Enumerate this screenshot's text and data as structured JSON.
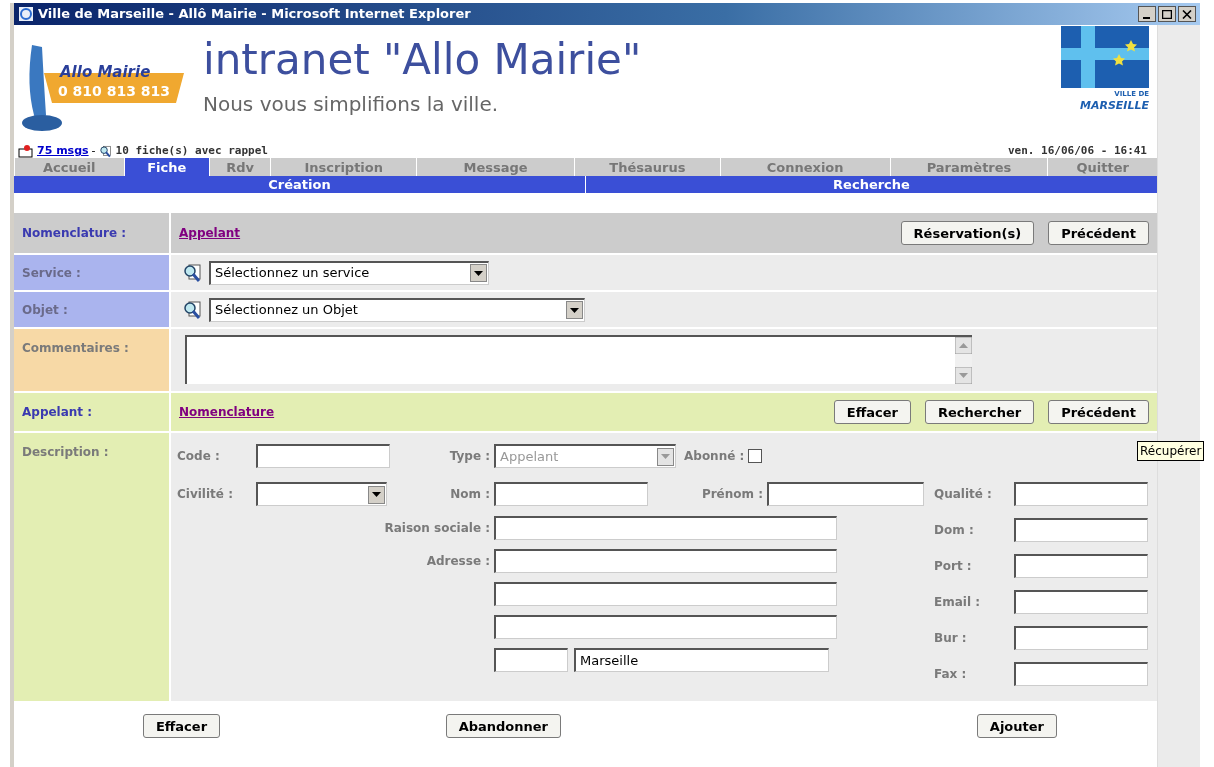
{
  "window": {
    "title": "Ville de Marseille - Allô Mairie - Microsoft Internet Explorer"
  },
  "header": {
    "logo_name": "Allo Mairie",
    "logo_phone": "0 810 813 813",
    "title": "intranet \"Allo Mairie\"",
    "slogan": "Nous vous simplifions la ville.",
    "city_logo": [
      "VILLE DE",
      "MARSEILLE"
    ]
  },
  "info_bar": {
    "messages_link": "75 msgs",
    "separator": "-",
    "reminders": "10 fiche(s) avec rappel",
    "datetime": "ven. 16/06/06 - 16:41"
  },
  "tabs": [
    {
      "label": "Accueil",
      "selected": false
    },
    {
      "label": "Fiche",
      "selected": true
    },
    {
      "label": "Rdv",
      "selected": false
    },
    {
      "label": "Inscription",
      "selected": false
    },
    {
      "label": "Message",
      "selected": false
    },
    {
      "label": "Thésaurus",
      "selected": false
    },
    {
      "label": "Connexion",
      "selected": false
    },
    {
      "label": "Paramètres",
      "selected": false
    },
    {
      "label": "Quitter",
      "selected": false
    }
  ],
  "subnav": [
    "Création",
    "Recherche"
  ],
  "nomenclature": {
    "label": "Nomenclature :",
    "link": "Appelant",
    "buttons": [
      "Réservation(s)",
      "Précédent"
    ]
  },
  "service": {
    "label": "Service :",
    "value": "Sélectionnez un service"
  },
  "objet": {
    "label": "Objet :",
    "value": "Sélectionnez un Objet"
  },
  "commentaires": {
    "label": "Commentaires :"
  },
  "appelant": {
    "label": "Appelant :",
    "link": "Nomenclature",
    "buttons": [
      "Effacer",
      "Rechercher",
      "Précédent"
    ]
  },
  "description": {
    "label": "Description :",
    "code": {
      "label": "Code :"
    },
    "type": {
      "label": "Type :",
      "value": "Appelant",
      "disabled": true
    },
    "abonne": {
      "label": "Abonné :",
      "checked": false
    },
    "civilite": {
      "label": "Civilité :"
    },
    "nom": {
      "label": "Nom :"
    },
    "prenom": {
      "label": "Prénom :"
    },
    "raison_sociale": {
      "label": "Raison sociale :"
    },
    "adresse": {
      "label": "Adresse :"
    },
    "ville": {
      "value": "Marseille"
    },
    "right_fields": [
      {
        "label": "Qualité :"
      },
      {
        "label": "Dom :"
      },
      {
        "label": "Port :"
      },
      {
        "label": "Email :"
      },
      {
        "label": "Bur :"
      },
      {
        "label": "Fax :"
      }
    ]
  },
  "footer_buttons": [
    "Effacer",
    "Abandonner",
    "Ajouter"
  ],
  "tooltip": "Récupérer"
}
